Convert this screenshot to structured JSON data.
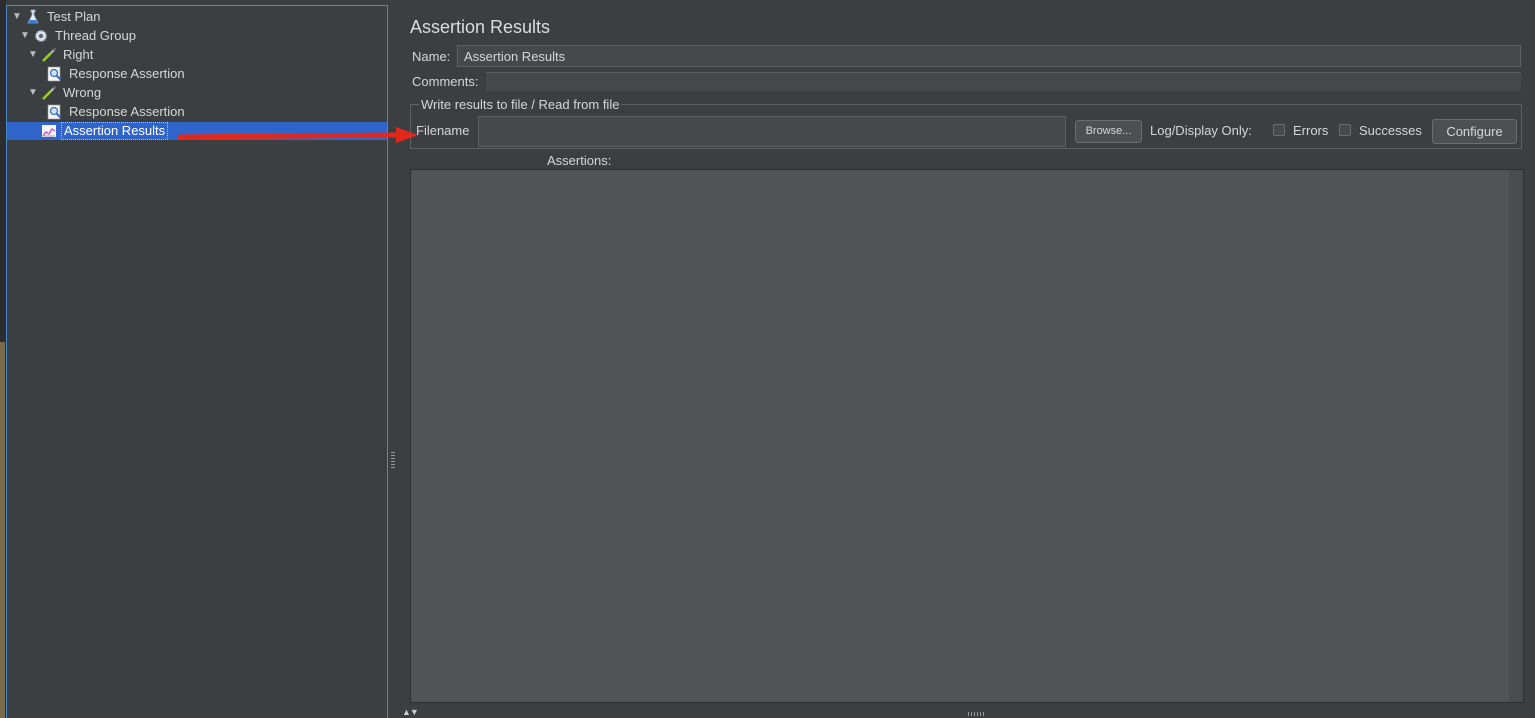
{
  "tree": {
    "items": [
      {
        "label": "Test Plan",
        "icon": "test-plan-flask-icon",
        "expanded": true
      },
      {
        "label": "Thread Group",
        "icon": "gear-icon",
        "expanded": true
      },
      {
        "label": "Right",
        "icon": "sampler-pipette-icon",
        "expanded": true
      },
      {
        "label": "Response Assertion",
        "icon": "magnifier-assertion-icon"
      },
      {
        "label": "Wrong",
        "icon": "sampler-pipette-icon",
        "expanded": true
      },
      {
        "label": "Response Assertion",
        "icon": "magnifier-assertion-icon"
      },
      {
        "label": "Assertion Results",
        "icon": "listener-chart-icon",
        "selected": true
      }
    ]
  },
  "panel": {
    "title": "Assertion Results",
    "name_label": "Name:",
    "name_value": "Assertion Results",
    "comments_label": "Comments:",
    "file_group_title": "Write results to file / Read from file",
    "filename_label": "Filename",
    "filename_value": "",
    "browse_label": "Browse...",
    "log_display_label": "Log/Display Only:",
    "errors_label": "Errors",
    "errors_checked": false,
    "successes_label": "Successes",
    "successes_checked": false,
    "configure_label": "Configure",
    "assertions_label": "Assertions:"
  },
  "colors": {
    "background": "#3c3f41",
    "selection": "#2f65ca",
    "annotation_arrow": "#e0281c"
  }
}
